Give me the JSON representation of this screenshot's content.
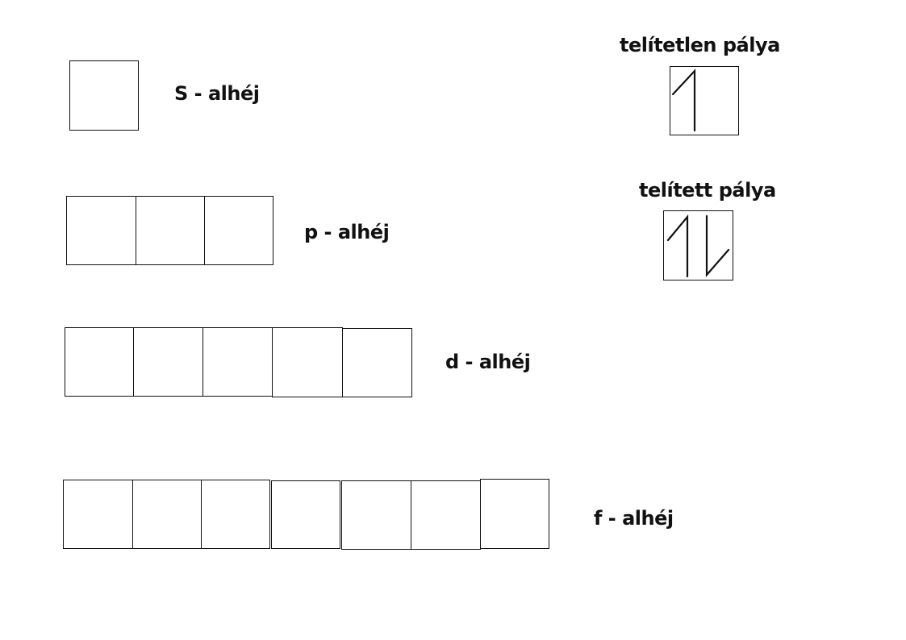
{
  "subshells": [
    {
      "key": "s",
      "label": "S - alhéj",
      "orbitals": 1
    },
    {
      "key": "p",
      "label": "p - alhéj",
      "orbitals": 3
    },
    {
      "key": "d",
      "label": "d - alhéj",
      "orbitals": 5
    },
    {
      "key": "f",
      "label": "f - alhéj",
      "orbitals": 7
    }
  ],
  "legend": {
    "unfilled_label": "telítetlen pálya",
    "filled_label": "telített pálya",
    "unfilled_electrons": 1,
    "filled_electrons": 2
  }
}
